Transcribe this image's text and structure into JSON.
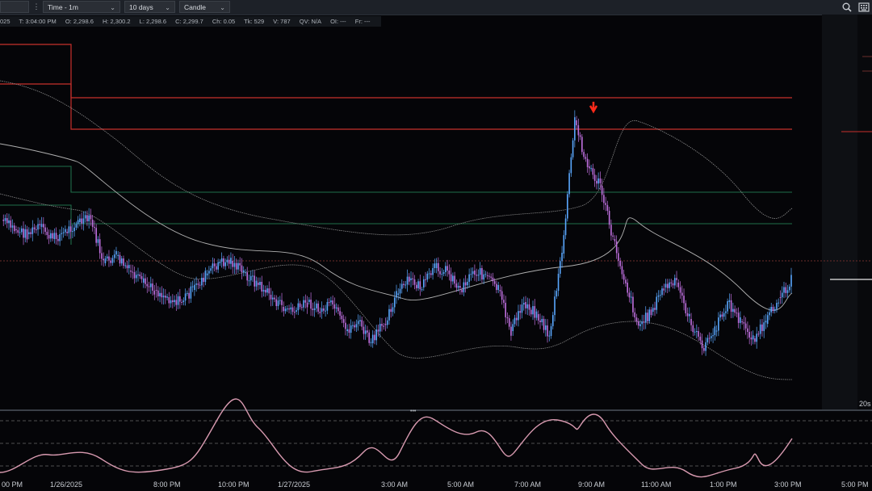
{
  "toolbar": {
    "symbol_tail": "",
    "interval": "Time - 1m",
    "range": "10 days",
    "chart_style": "Candle",
    "search_icon": "search-icon",
    "menu_icon": "keyboard-icon"
  },
  "infobar": {
    "date_tail": "025",
    "time": "T: 3:04:00 PM",
    "open": "O: 2,298.6",
    "high": "H: 2,300.2",
    "low": "L: 2,298.6",
    "close": "C: 2,299.7",
    "change": "Ch: 0.05",
    "ticks": "Tk: 529",
    "volume": "V: 787",
    "qv": "QV: N/A",
    "oi": "OI: ---",
    "fr": "Fr: ---"
  },
  "right_axis": {
    "bar_label": "20s"
  },
  "time_axis": [
    "00 PM",
    "1/26/2025",
    "8:00 PM",
    "10:00 PM",
    "1/27/2025",
    "3:00 AM",
    "5:00 AM",
    "7:00 AM",
    "9:00 AM",
    "11:00 AM",
    "1:00 PM",
    "3:00 PM",
    "5:00 PM"
  ],
  "colors": {
    "background": "#050508",
    "candle_up": "#5aa8ff",
    "candle_down": "#c070e0",
    "resistance": "#c8302c",
    "support": "#1f6e4a",
    "band": "#8a8a8a",
    "oscillator": "#d89ab0",
    "signal_arrow": "#ff2a1a"
  },
  "chart_data": {
    "type": "line",
    "description_series": [
      {
        "values": [
          56,
          52,
          50,
          53,
          48,
          51,
          55,
          56,
          38,
          41,
          35,
          30,
          27,
          24,
          22,
          27,
          33,
          38,
          39,
          34,
          30,
          25,
          20,
          18,
          22,
          18,
          21,
          10,
          14,
          5,
          13,
          25,
          31,
          28,
          36,
          35,
          27,
          35,
          33,
          27,
          10,
          22,
          17,
          8,
          42,
          97,
          78,
          70,
          48,
          30,
          12,
          18,
          28,
          30,
          15,
          3,
          10,
          22,
          14,
          7,
          13,
          24,
          31
        ]
      }
    ],
    "oscillator_levels": [
      "upper",
      "middle",
      "lower"
    ]
  }
}
